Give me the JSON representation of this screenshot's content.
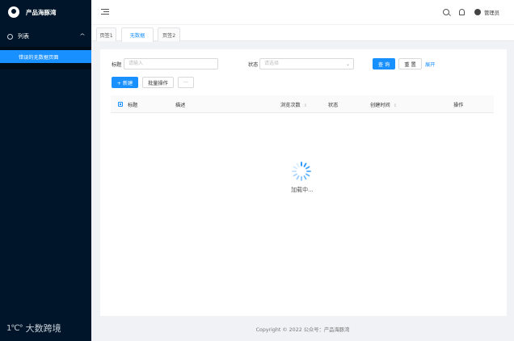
{
  "app": {
    "title": "产品海豚湾"
  },
  "sidebar": {
    "group": {
      "label": "列表",
      "icon": "list-circle-icon",
      "caret": "^"
    },
    "items": [
      {
        "label": "错误的无数据页面",
        "active": true
      }
    ],
    "watermark": {
      "logo": "1℃°",
      "text": "大数跨境"
    }
  },
  "header": {
    "icons": [
      "menu-fold-icon",
      "search-icon",
      "bell-icon"
    ],
    "user": "管理员"
  },
  "tabs": [
    {
      "label": "页签1",
      "active": false
    },
    {
      "label": "无数据",
      "active": true
    },
    {
      "label": "页签2",
      "active": false
    }
  ],
  "filters": {
    "title_label": "标题",
    "title_placeholder": "请输入",
    "status_label": "状态",
    "status_placeholder": "请选择",
    "status_caret": "⌄",
    "search_button": "查 询",
    "reset_button": "重 置",
    "expand_link": "展开"
  },
  "actions": {
    "new_button": "+ 新建",
    "batch_button": "批量操作",
    "more_button": "···"
  },
  "table": {
    "columns": [
      "标题",
      "描述",
      "浏览次数",
      "状态",
      "创建时间",
      "操作"
    ],
    "sortable": {
      "views": "↕",
      "created": "↕"
    }
  },
  "loading": {
    "text": "加载中..."
  },
  "footer": {
    "text": "Copyright © 2022 公众号：产品海豚湾"
  },
  "colors": {
    "primary": "#1890ff",
    "sidebar_bg": "#001529",
    "page_bg": "#f0f2f5"
  }
}
